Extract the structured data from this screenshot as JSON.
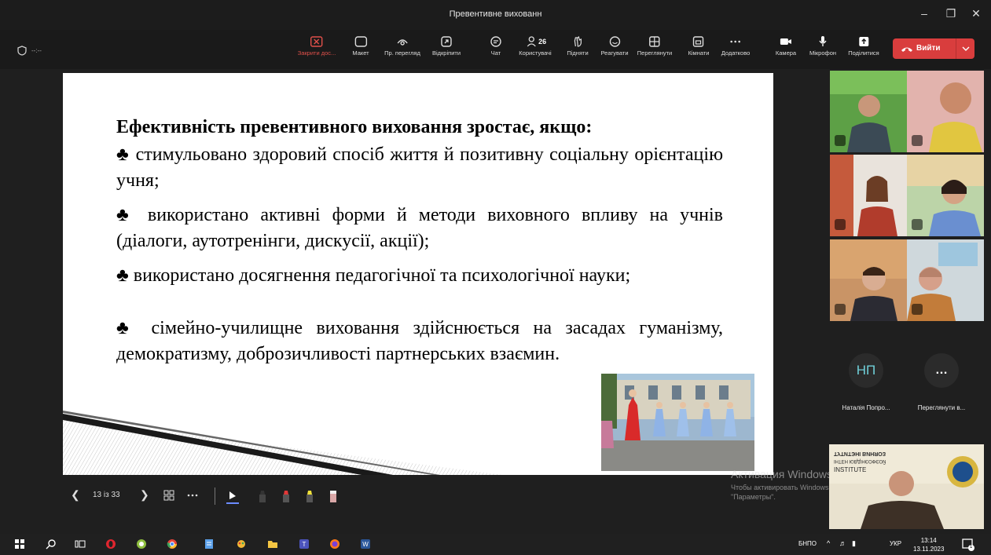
{
  "window": {
    "title": "Превентивне вихованн",
    "controls": [
      "–",
      "❐",
      "✕"
    ]
  },
  "meeting": {
    "timer": "--:--"
  },
  "toolbar": {
    "items": [
      {
        "label": "Закрити дос...",
        "icon": "close-share-icon",
        "red": true
      },
      {
        "label": "Макет",
        "icon": "layout-icon"
      },
      {
        "label": "Пр. перегляд",
        "icon": "eye-icon"
      },
      {
        "label": "Відкріпити",
        "icon": "unpin-icon"
      },
      {
        "label": "Чат",
        "icon": "chat-icon"
      },
      {
        "label": "Користувачі",
        "icon": "people-icon",
        "badge": "26"
      },
      {
        "label": "Підняти",
        "icon": "hand-icon"
      },
      {
        "label": "Реагувати",
        "icon": "smile-icon"
      },
      {
        "label": "Переглянути",
        "icon": "view-icon"
      },
      {
        "label": "Кімнати",
        "icon": "rooms-icon"
      },
      {
        "label": "Додатково",
        "icon": "more-icon"
      },
      {
        "label": "Камера",
        "icon": "camera-icon"
      },
      {
        "label": "Мікрофон",
        "icon": "mic-icon"
      },
      {
        "label": "Поділитися",
        "icon": "share-icon"
      }
    ],
    "leave": "Вийти"
  },
  "slide": {
    "title": "Ефективність превентивного виховання зростає, якщо:",
    "bullets": [
      "♣ стимульовано здоровий спосіб життя й позитивну соціальну орієнтацію учня;",
      "♣ використано активні форми й методи виховного впливу на учнів (діалоги, аутотренінги, дискусії, акції);",
      "♣ використано досягнення педагогічної та психологічної науки;",
      "♣ сімейно-училищне виховання здійснюється на засадах гуманізму, демократизму, доброзичливості партнерських взаємин."
    ]
  },
  "pager": {
    "count": "13 із 33"
  },
  "participants": {
    "avatar_initials": "НП",
    "avatar_name": "Наталія Попро...",
    "more_label": "Переглянути в...",
    "more_icon": "…"
  },
  "activation": {
    "line1": "Активация Windows",
    "line2": "Чтобы активировать Windows, перейдите в",
    "line3": "\"Параметры\"."
  },
  "selfview": {
    "banner1": "ТУТИТЭНІ ВИНЯОЗ",
    "banner2": "ІНТЕН ЮВДІНЄОФЄОЙ",
    "banner3": "INSTITUTE"
  },
  "taskbar": {
    "lang_app": "БНПО",
    "lang": "УКР",
    "time": "13:14",
    "date": "13.11.2023",
    "notif": "1"
  },
  "colors": {
    "leave": "#d93d3d",
    "avatar_text": "#6fcfd8",
    "close_share": "#e0504a"
  }
}
